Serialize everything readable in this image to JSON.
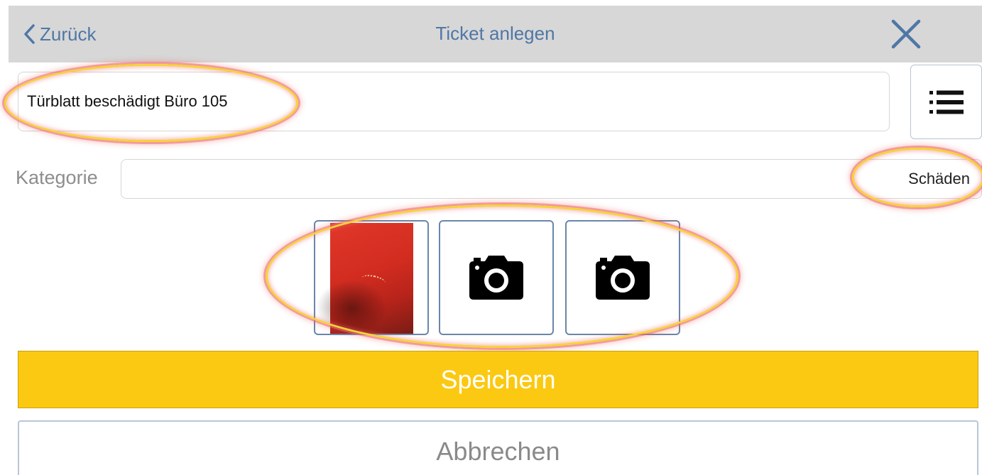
{
  "navbar": {
    "back_label": "Zurück",
    "title": "Ticket anlegen",
    "back_icon": "chevron-left-icon",
    "close_icon": "close-icon"
  },
  "ticket": {
    "title_value": "Türblatt beschädigt Büro 105",
    "list_icon": "list-icon"
  },
  "category": {
    "label": "Kategorie",
    "value": "Schäden"
  },
  "photos": {
    "slots": [
      {
        "state": "photo",
        "content": "red door surface with scratch"
      },
      {
        "state": "empty",
        "icon": "camera-icon"
      },
      {
        "state": "empty",
        "icon": "camera-icon"
      }
    ]
  },
  "actions": {
    "save_label": "Speichern",
    "cancel_label": "Abbrechen"
  },
  "colors": {
    "navbar_bg": "#d7d7d7",
    "nav_text": "#4f77a6",
    "save_bg": "#fbc912",
    "annotation": "#f5d33a"
  }
}
